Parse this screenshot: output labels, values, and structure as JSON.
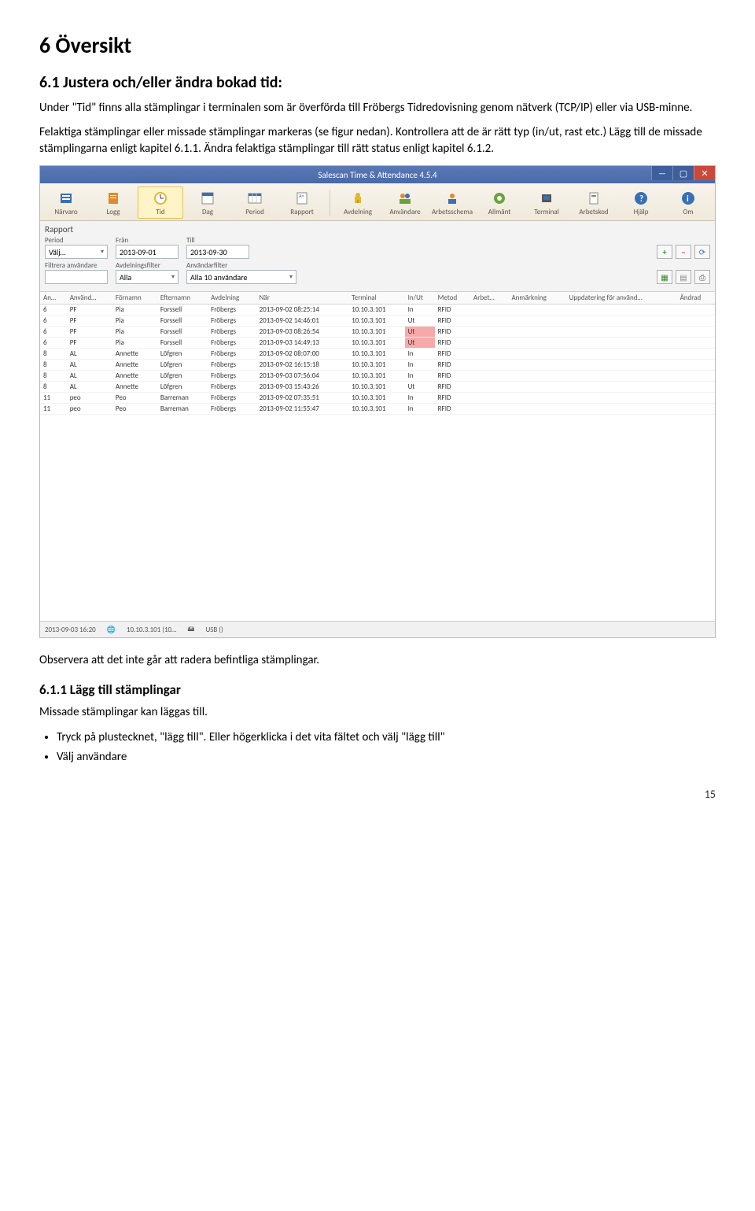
{
  "doc": {
    "h1": "6  Översikt",
    "h2": "6.1 Justera och/eller ändra bokad tid:",
    "p1": "Under \"Tid\" finns alla stämplingar i terminalen som är överförda till Fröbergs Tidredovisning genom nätverk (TCP/IP) eller via USB-minne.",
    "p2": "Felaktiga stämplingar eller missade stämplingar markeras (se figur nedan). Kontrollera att de är rätt typ (in/ut, rast etc.) Lägg till de missade stämplingarna enligt kapitel 6.1.1. Ändra felaktiga stämplingar till rätt status enligt kapitel 6.1.2.",
    "p3": "Observera att det inte går att radera befintliga stämplingar.",
    "h3": "6.1.1 Lägg till stämplingar",
    "p4": "Missade stämplingar kan läggas till.",
    "bullets": [
      "Tryck på plustecknet, \"lägg till\". Eller högerklicka i det vita fältet och välj \"lägg till\"",
      "Välj användare"
    ],
    "page_num": "15"
  },
  "app": {
    "title": "Salescan Time & Attendance 4.5.4",
    "ribbon": [
      "Närvaro",
      "Logg",
      "Tid",
      "Dag",
      "Period",
      "Rapport",
      "",
      "Avdelning",
      "Användare",
      "Arbetsschema",
      "Allmänt",
      "Terminal",
      "Arbetskod",
      "Hjälp",
      "Om"
    ],
    "ribbon_selected_idx": 2,
    "filter": {
      "section": "Rapport",
      "period_lbl": "Period",
      "period_val": "Välj…",
      "from_lbl": "Från",
      "from_val": "2013-09-01",
      "to_lbl": "Till",
      "to_val": "2013-09-30",
      "filter_user_lbl": "Filtrera användare",
      "dept_lbl": "Avdelningsfilter",
      "dept_val": "Alla",
      "userfilter_lbl": "Användarfilter",
      "userfilter_val": "Alla 10 användare"
    },
    "headers": [
      "An…",
      "Använd…",
      "Förnamn",
      "Efternamn",
      "Avdelning",
      "När",
      "Terminal",
      "In/Ut",
      "Metod",
      "Arbet…",
      "Anmärkning",
      "Uppdatering för använd…",
      "Ändrad"
    ],
    "rows": [
      {
        "no": "6",
        "u": "PF",
        "fn": "Pia",
        "ln": "Forssell",
        "dep": "Fröbergs",
        "when": "2013-09-02 08:25:14",
        "term": "10.10.3.101",
        "io": "In",
        "m": "RFID",
        "hl": false
      },
      {
        "no": "6",
        "u": "PF",
        "fn": "Pia",
        "ln": "Forssell",
        "dep": "Fröbergs",
        "when": "2013-09-02 14:46:01",
        "term": "10.10.3.101",
        "io": "Ut",
        "m": "RFID",
        "hl": false
      },
      {
        "no": "6",
        "u": "PF",
        "fn": "Pia",
        "ln": "Forssell",
        "dep": "Fröbergs",
        "when": "2013-09-03 08:26:54",
        "term": "10.10.3.101",
        "io": "Ut",
        "m": "RFID",
        "hl": true
      },
      {
        "no": "6",
        "u": "PF",
        "fn": "Pia",
        "ln": "Forssell",
        "dep": "Fröbergs",
        "when": "2013-09-03 14:49:13",
        "term": "10.10.3.101",
        "io": "Ut",
        "m": "RFID",
        "hl": true
      },
      {
        "no": "8",
        "u": "AL",
        "fn": "Annette",
        "ln": "Löfgren",
        "dep": "Fröbergs",
        "when": "2013-09-02 08:07:00",
        "term": "10.10.3.101",
        "io": "In",
        "m": "RFID",
        "hl": false
      },
      {
        "no": "8",
        "u": "AL",
        "fn": "Annette",
        "ln": "Löfgren",
        "dep": "Fröbergs",
        "when": "2013-09-02 16:15:18",
        "term": "10.10.3.101",
        "io": "In",
        "m": "RFID",
        "hl": false
      },
      {
        "no": "8",
        "u": "AL",
        "fn": "Annette",
        "ln": "Löfgren",
        "dep": "Fröbergs",
        "when": "2013-09-03 07:56:04",
        "term": "10.10.3.101",
        "io": "In",
        "m": "RFID",
        "hl": false
      },
      {
        "no": "8",
        "u": "AL",
        "fn": "Annette",
        "ln": "Löfgren",
        "dep": "Fröbergs",
        "when": "2013-09-03 15:43:26",
        "term": "10.10.3.101",
        "io": "Ut",
        "m": "RFID",
        "hl": false
      },
      {
        "no": "11",
        "u": "peo",
        "fn": "Peo",
        "ln": "Barreman",
        "dep": "Fröbergs",
        "when": "2013-09-02 07:35:51",
        "term": "10.10.3.101",
        "io": "In",
        "m": "RFID",
        "hl": false
      },
      {
        "no": "11",
        "u": "peo",
        "fn": "Peo",
        "ln": "Barreman",
        "dep": "Fröbergs",
        "when": "2013-09-02 11:55:47",
        "term": "10.10.3.101",
        "io": "In",
        "m": "RFID",
        "hl": false
      }
    ],
    "status": {
      "time": "2013-09-03 16:20",
      "ip": "10.10.3.101 (10…",
      "usb": "USB ()"
    }
  }
}
